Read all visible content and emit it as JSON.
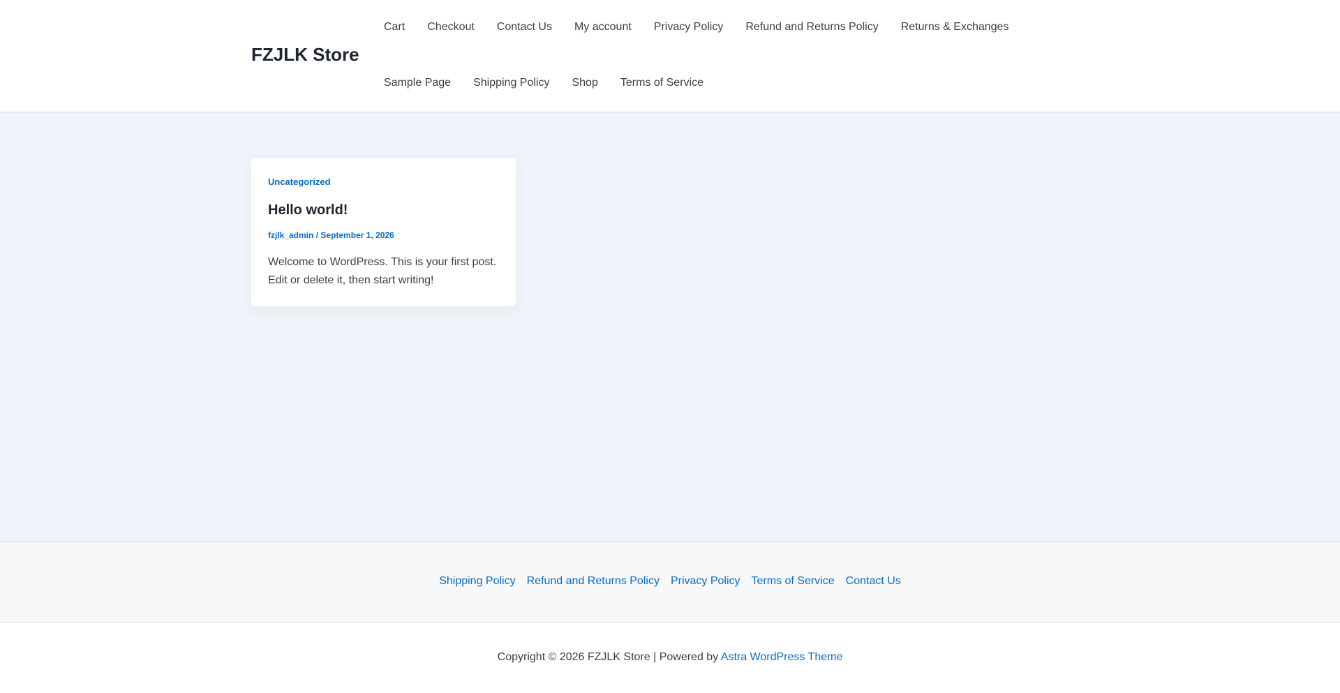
{
  "header": {
    "site_title": "FZJLK Store",
    "nav_row1": [
      "Cart",
      "Checkout",
      "Contact Us",
      "My account",
      "Privacy Policy",
      "Refund and Returns Policy",
      "Returns & Exchanges"
    ],
    "nav_row2": [
      "Sample Page",
      "Shipping Policy",
      "Shop",
      "Terms of Service"
    ]
  },
  "post": {
    "category": "Uncategorized",
    "title": "Hello world!",
    "author": "fzjlk_admin",
    "separator": "/",
    "date": "September 1, 2026",
    "excerpt": "Welcome to WordPress. This is your first post. Edit or delete it, then start writing!"
  },
  "footer": {
    "links": [
      "Shipping Policy",
      "Refund and Returns Policy",
      "Privacy Policy",
      "Terms of Service",
      "Contact Us"
    ],
    "copyright_prefix": "Copyright © 2026 FZJLK Store | Powered by",
    "theme_link": "Astra WordPress Theme"
  },
  "colors": {
    "link": "#0a6cc2",
    "page_background": "#eff4fa",
    "heading": "#1e2430"
  }
}
